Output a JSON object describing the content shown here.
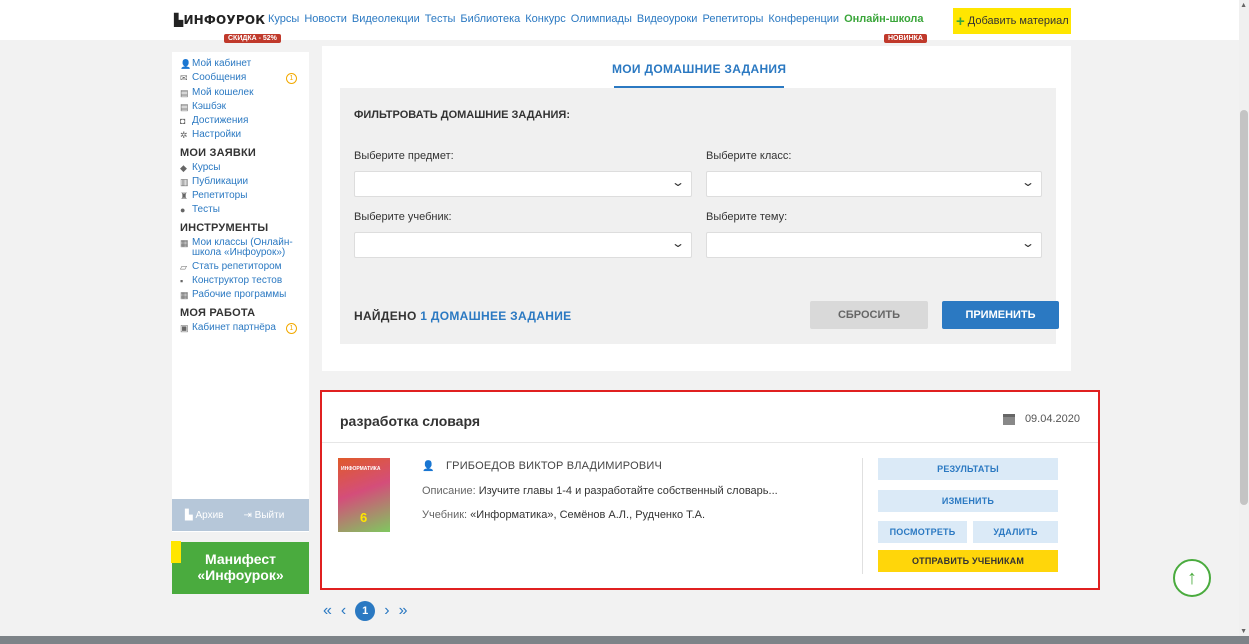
{
  "header": {
    "logo": "ИНФОУРОК",
    "nav": [
      "Курсы",
      "Новости",
      "Видеолекции",
      "Тесты",
      "Библиотека",
      "Конкурс",
      "Олимпиады",
      "Видеоуроки",
      "Репетиторы",
      "Конференции"
    ],
    "online_school": "Онлайн-школа",
    "add_material": "Добавить материал",
    "sale_badge": "СКИДКА - 52%",
    "new_badge": "НОВИНКА"
  },
  "sidebar": {
    "items": [
      {
        "icon": "user-icon",
        "glyph": "👤",
        "label": "Мой кабинет"
      },
      {
        "icon": "mail-icon",
        "glyph": "✉",
        "label": "Сообщения",
        "count": "1"
      },
      {
        "icon": "wallet-icon",
        "glyph": "▤",
        "label": "Мой кошелек"
      },
      {
        "icon": "cashback-icon",
        "glyph": "▤",
        "label": "Кэшбэк"
      },
      {
        "icon": "trophy-icon",
        "glyph": "◘",
        "label": "Достижения"
      },
      {
        "icon": "gear-icon",
        "glyph": "✲",
        "label": "Настройки"
      }
    ],
    "section_requests": "МОИ ЗАЯВКИ",
    "requests": [
      {
        "icon": "graduation-icon",
        "glyph": "◆",
        "label": "Курсы"
      },
      {
        "icon": "publication-icon",
        "glyph": "▥",
        "label": "Публикации"
      },
      {
        "icon": "tutor-icon",
        "glyph": "♜",
        "label": "Репетиторы"
      },
      {
        "icon": "check-icon",
        "glyph": "●",
        "label": "Тесты"
      }
    ],
    "section_tools": "ИНСТРУМЕНТЫ",
    "tools": [
      {
        "icon": "classes-icon",
        "glyph": "▦",
        "label": "Мои классы (Онлайн-школа «Инфоурок»)"
      },
      {
        "icon": "tutor-board-icon",
        "glyph": "▱",
        "label": "Стать репетитором"
      },
      {
        "icon": "grid-icon",
        "glyph": "▪",
        "label": "Конструктор тестов"
      },
      {
        "icon": "calendar-icon",
        "glyph": "▦",
        "label": "Рабочие программы"
      }
    ],
    "section_work": "МОЯ РАБОТА",
    "work": [
      {
        "icon": "partner-icon",
        "glyph": "▣",
        "label": "Кабинет партнёра",
        "count": "1"
      }
    ],
    "archive": "Архив",
    "logout": "Выйти",
    "manifest_line1": "Манифест",
    "manifest_line2": "«Инфоурок»"
  },
  "main": {
    "tab": "МОИ ДОМАШНИЕ ЗАДАНИЯ",
    "filter_title": "ФИЛЬТРОВАТЬ ДОМАШНИЕ ЗАДАНИЯ:",
    "subject_label": "Выберите предмет:",
    "class_label": "Выберите класс:",
    "textbook_label": "Выберите учебник:",
    "topic_label": "Выберите тему:",
    "found_prefix": "НАЙДЕНО",
    "found_count": "1 ДОМАШНЕЕ ЗАДАНИЕ",
    "reset": "СБРОСИТЬ",
    "apply": "ПРИМЕНИТЬ"
  },
  "homework": {
    "title": "разработка словаря",
    "date": "09.04.2020",
    "author": "ГРИБОЕДОВ ВИКТОР ВЛАДИМИРОВИЧ",
    "desc_label": "Описание:",
    "desc": "Изучите главы 1-4 и разработайте собственный словарь...",
    "textbook_label": "Учебник:",
    "textbook": "«Информатика», Семёнов А.Л., Рудченко Т.А.",
    "book_title": "ИНФОРМАТИКА",
    "book_number": "6",
    "results": "РЕЗУЛЬТАТЫ",
    "edit": "ИЗМЕНИТЬ",
    "view": "ПОСМОТРЕТЬ",
    "delete": "УДАЛИТЬ",
    "send": "ОТПРАВИТЬ УЧЕНИКАМ"
  },
  "pagination": {
    "first": "«",
    "prev": "‹",
    "current": "1",
    "next": "›",
    "last": "»"
  }
}
